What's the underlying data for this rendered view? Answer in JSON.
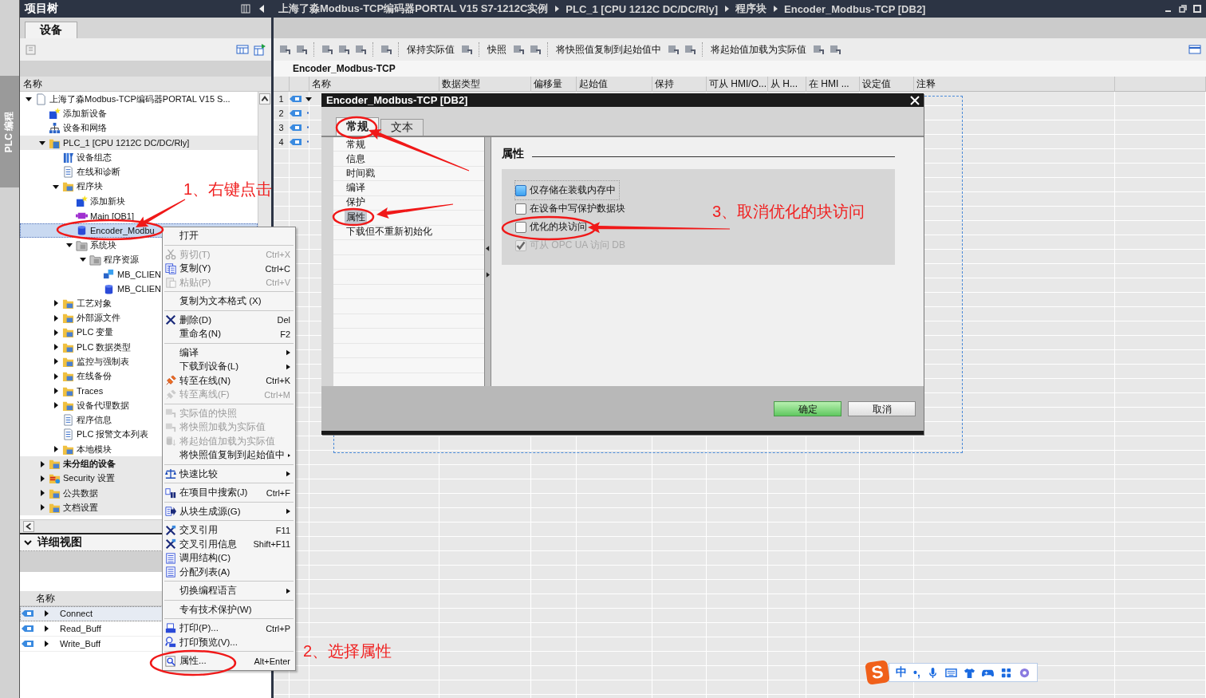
{
  "side_tab": {
    "label": "PLC 编程"
  },
  "project_tree": {
    "title": "项目树",
    "tab": "设备",
    "column": "名称",
    "items": [
      {
        "label": "上海了淼Modbus-TCP编码器PORTAL V15 S...",
        "kind": "project",
        "expandable": true,
        "expanded": true,
        "selected": false,
        "children": [
          {
            "label": "添加新设备",
            "kind": "add",
            "expandable": false,
            "selected": false
          },
          {
            "label": "设备和网络",
            "kind": "network",
            "expandable": false,
            "selected": false
          },
          {
            "label": "PLC_1 [CPU 1212C DC/DC/Rly]",
            "kind": "plc",
            "expandable": true,
            "expanded": true,
            "selected": false,
            "children": [
              {
                "label": "设备组态",
                "kind": "config",
                "expandable": false,
                "selected": false
              },
              {
                "label": "在线和诊断",
                "kind": "diagnostics",
                "expandable": false,
                "selected": false
              },
              {
                "label": "程序块",
                "kind": "folder",
                "expandable": true,
                "expanded": true,
                "selected": false,
                "children": [
                  {
                    "label": "添加新块",
                    "kind": "add",
                    "expandable": false,
                    "selected": false
                  },
                  {
                    "label": "Main [OB1]",
                    "kind": "block",
                    "expandable": false,
                    "selected": false
                  },
                  {
                    "label": "Encoder_Modbu",
                    "kind": "db",
                    "expandable": false,
                    "selected": true
                  },
                  {
                    "label": "系统块",
                    "kind": "system-folder",
                    "expandable": true,
                    "expanded": true,
                    "selected": false,
                    "children": [
                      {
                        "label": "程序资源",
                        "kind": "system-folder",
                        "expandable": true,
                        "expanded": true,
                        "selected": false,
                        "children": [
                          {
                            "label": "MB_CLIEN",
                            "kind": "fb",
                            "expandable": false,
                            "selected": false
                          },
                          {
                            "label": "MB_CLIEN",
                            "kind": "db",
                            "expandable": false,
                            "selected": false
                          }
                        ]
                      }
                    ]
                  }
                ]
              },
              {
                "label": "工艺对象",
                "kind": "folder",
                "expandable": true,
                "expanded": false,
                "selected": false
              },
              {
                "label": "外部源文件",
                "kind": "folder",
                "expandable": true,
                "expanded": false,
                "selected": false
              },
              {
                "label": "PLC 变量",
                "kind": "folder",
                "expandable": true,
                "expanded": false,
                "selected": false
              },
              {
                "label": "PLC 数据类型",
                "kind": "folder",
                "expandable": true,
                "expanded": false,
                "selected": false
              },
              {
                "label": "监控与强制表",
                "kind": "folder",
                "expandable": true,
                "expanded": false,
                "selected": false
              },
              {
                "label": "在线备份",
                "kind": "folder",
                "expandable": true,
                "expanded": false,
                "selected": false
              },
              {
                "label": "Traces",
                "kind": "folder",
                "expandable": true,
                "expanded": false,
                "selected": false
              },
              {
                "label": "设备代理数据",
                "kind": "folder",
                "expandable": true,
                "expanded": false,
                "selected": false
              },
              {
                "label": "程序信息",
                "kind": "doc",
                "expandable": false,
                "selected": false
              },
              {
                "label": "PLC 报警文本列表",
                "kind": "doc",
                "expandable": false,
                "selected": false
              },
              {
                "label": "本地模块",
                "kind": "folder",
                "expandable": true,
                "expanded": false,
                "selected": false
              }
            ]
          },
          {
            "label": "未分组的设备",
            "kind": "folder",
            "bold": true,
            "expandable": true,
            "expanded": false,
            "selected": false
          },
          {
            "label": "Security 设置",
            "kind": "security",
            "expandable": true,
            "expanded": false,
            "selected": false
          },
          {
            "label": "公共数据",
            "kind": "folder",
            "expandable": true,
            "expanded": false,
            "selected": false
          },
          {
            "label": "文档设置",
            "kind": "folder",
            "expandable": true,
            "expanded": false,
            "selected": false
          }
        ]
      }
    ]
  },
  "details_view": {
    "title": "详细视图",
    "column": "名称",
    "rows": [
      {
        "label": "Connect",
        "selected": true
      },
      {
        "label": "Read_Buff",
        "selected": false
      },
      {
        "label": "Write_Buff",
        "selected": false
      }
    ]
  },
  "breadcrumb": [
    "上海了淼Modbus-TCP编码器PORTAL V15 S7-1212C实例",
    "PLC_1 [CPU 1212C DC/DC/Rly]",
    "程序块",
    "Encoder_Modbus-TCP [DB2]"
  ],
  "toolbar": [
    {
      "kind": "icon"
    },
    {
      "kind": "icon"
    },
    {
      "kind": "separator"
    },
    {
      "kind": "icon"
    },
    {
      "kind": "icon"
    },
    {
      "kind": "icon"
    },
    {
      "kind": "separator"
    },
    {
      "kind": "icon"
    },
    {
      "kind": "separator"
    },
    {
      "kind": "text",
      "label": "保持实际值"
    },
    {
      "kind": "icon"
    },
    {
      "kind": "separator"
    },
    {
      "kind": "text",
      "label": "快照"
    },
    {
      "kind": "icon"
    },
    {
      "kind": "icon"
    },
    {
      "kind": "separator"
    },
    {
      "kind": "text",
      "label": "将快照值复制到起始值中"
    },
    {
      "kind": "icon"
    },
    {
      "kind": "icon"
    },
    {
      "kind": "separator"
    },
    {
      "kind": "text",
      "label": "将起始值加载为实际值"
    },
    {
      "kind": "icon"
    },
    {
      "kind": "icon"
    }
  ],
  "editor": {
    "block_name": "Encoder_Modbus-TCP",
    "columns": [
      "名称",
      "数据类型",
      "偏移量",
      "起始值",
      "保持",
      "可从 HMI/O...",
      "从 H...",
      "在 HMI ...",
      "设定值",
      "注释"
    ],
    "rows": [
      {
        "number": "1",
        "expandable": true
      },
      {
        "number": "2",
        "expandable": false
      },
      {
        "number": "3",
        "expandable": false
      },
      {
        "number": "4",
        "expandable": false
      }
    ]
  },
  "context_menu": [
    {
      "kind": "plain",
      "label": "打开",
      "disabled": false,
      "submenu": false
    },
    {
      "kind": "separator"
    },
    {
      "kind": "cut",
      "label": "剪切(T)",
      "shortcut": "Ctrl+X",
      "disabled": true,
      "submenu": false
    },
    {
      "kind": "copy",
      "label": "复制(Y)",
      "shortcut": "Ctrl+C",
      "disabled": false,
      "submenu": false
    },
    {
      "kind": "paste",
      "label": "粘贴(P)",
      "shortcut": "Ctrl+V",
      "disabled": true,
      "submenu": false
    },
    {
      "kind": "separator"
    },
    {
      "kind": "plain",
      "label": "复制为文本格式 (X)",
      "disabled": false,
      "submenu": false
    },
    {
      "kind": "separator"
    },
    {
      "kind": "delete",
      "label": "删除(D)",
      "shortcut": "Del",
      "disabled": false,
      "submenu": false
    },
    {
      "kind": "plain",
      "label": "重命名(N)",
      "shortcut": "F2",
      "disabled": false,
      "submenu": false
    },
    {
      "kind": "separator"
    },
    {
      "kind": "plain",
      "label": "编译",
      "disabled": false,
      "submenu": true
    },
    {
      "kind": "plain",
      "label": "下载到设备(L)",
      "disabled": false,
      "submenu": true
    },
    {
      "kind": "online",
      "label": "转至在线(N)",
      "shortcut": "Ctrl+K",
      "disabled": false,
      "submenu": false
    },
    {
      "kind": "online",
      "label": "转至离线(F)",
      "shortcut": "Ctrl+M",
      "disabled": true,
      "submenu": false
    },
    {
      "kind": "separator"
    },
    {
      "kind": "snapshot",
      "label": "实际值的快照",
      "disabled": true,
      "submenu": false
    },
    {
      "kind": "snapshot",
      "label": "将快照加载为实际值",
      "disabled": true,
      "submenu": false
    },
    {
      "kind": "load",
      "label": "将起始值加载为实际值",
      "disabled": true,
      "submenu": false
    },
    {
      "kind": "plain",
      "label": "将快照值复制到起始值中",
      "disabled": false,
      "submenu": true
    },
    {
      "kind": "separator"
    },
    {
      "kind": "compare",
      "label": "快速比较",
      "disabled": false,
      "submenu": true
    },
    {
      "kind": "separator"
    },
    {
      "kind": "search",
      "label": "在项目中搜索(J)",
      "shortcut": "Ctrl+F",
      "disabled": false,
      "submenu": false
    },
    {
      "kind": "separator"
    },
    {
      "kind": "source",
      "label": "从块生成源(G)",
      "disabled": false,
      "submenu": true
    },
    {
      "kind": "separator"
    },
    {
      "kind": "xref",
      "label": "交叉引用",
      "shortcut": "F11",
      "disabled": false,
      "submenu": false
    },
    {
      "kind": "xref",
      "label": "交叉引用信息",
      "shortcut": "Shift+F11",
      "disabled": false,
      "submenu": false
    },
    {
      "kind": "list",
      "label": "调用结构(C)",
      "disabled": false,
      "submenu": false
    },
    {
      "kind": "list",
      "label": "分配列表(A)",
      "disabled": false,
      "submenu": false
    },
    {
      "kind": "separator"
    },
    {
      "kind": "plain",
      "label": "切换编程语言",
      "disabled": false,
      "submenu": true
    },
    {
      "kind": "separator"
    },
    {
      "kind": "plain",
      "label": "专有技术保护(W)",
      "disabled": false,
      "submenu": false
    },
    {
      "kind": "separator"
    },
    {
      "kind": "print",
      "label": "打印(P)...",
      "shortcut": "Ctrl+P",
      "disabled": false,
      "submenu": false
    },
    {
      "kind": "preview",
      "label": "打印预览(V)...",
      "disabled": false,
      "submenu": false
    },
    {
      "kind": "separator"
    },
    {
      "kind": "properties",
      "label": "属性...",
      "shortcut": "Alt+Enter",
      "disabled": false,
      "submenu": false
    }
  ],
  "dialog": {
    "title": "Encoder_Modbus-TCP [DB2]",
    "tabs": [
      {
        "label": "常规",
        "selected": true
      },
      {
        "label": "文本",
        "selected": false
      }
    ],
    "nav": [
      {
        "label": "常规",
        "selected": false
      },
      {
        "label": "信息",
        "selected": false
      },
      {
        "label": "时间戳",
        "selected": false
      },
      {
        "label": "编译",
        "selected": false
      },
      {
        "label": "保护",
        "selected": false
      },
      {
        "label": "属性",
        "selected": true
      },
      {
        "label": "下载但不重新初始化",
        "selected": false
      }
    ],
    "section": "属性",
    "options": [
      {
        "label": "仅存储在装载内存中",
        "checked": false,
        "disabled": false,
        "focused": true
      },
      {
        "label": "在设备中写保护数据块",
        "checked": false,
        "disabled": false,
        "focused": false
      },
      {
        "label": "优化的块访问",
        "checked": false,
        "disabled": false,
        "focused": false
      },
      {
        "label": "可从 OPC UA 访问 DB",
        "checked": true,
        "disabled": true,
        "focused": false
      }
    ],
    "buttons": [
      {
        "label": "确定",
        "kind": "primary"
      },
      {
        "label": "取消",
        "kind": "secondary"
      }
    ]
  },
  "annotations": [
    {
      "text": "1、右键点击"
    },
    {
      "text": "2、选择属性"
    },
    {
      "text": "3、取消优化的块访问"
    }
  ],
  "ime_bar": {
    "logo": "S",
    "mode": "中",
    "punctuation": "•,"
  }
}
